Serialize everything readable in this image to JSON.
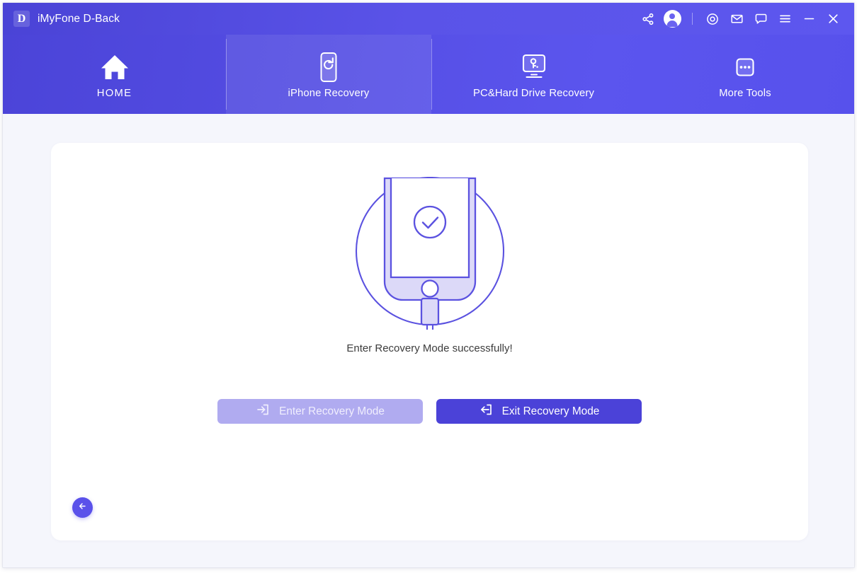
{
  "window": {
    "logo_letter": "D",
    "title": "iMyFone D-Back"
  },
  "titlebar": {
    "icons": [
      {
        "name": "share-icon",
        "glyph": "share"
      },
      {
        "name": "account-avatar-icon",
        "glyph": "avatar"
      },
      {
        "name": "separator",
        "glyph": "sep"
      },
      {
        "name": "target-icon",
        "glyph": "target"
      },
      {
        "name": "mail-icon",
        "glyph": "mail"
      },
      {
        "name": "feedback-chat-icon",
        "glyph": "chat"
      },
      {
        "name": "menu-icon",
        "glyph": "hamburger"
      },
      {
        "name": "minimize-icon",
        "glyph": "minimize"
      },
      {
        "name": "close-icon",
        "glyph": "close"
      }
    ]
  },
  "nav": {
    "tabs": [
      {
        "label": "HOME",
        "icon": "home-icon",
        "active": false
      },
      {
        "label": "iPhone Recovery",
        "icon": "phone-refresh-icon",
        "active": true
      },
      {
        "label": "PC&Hard Drive Recovery",
        "icon": "monitor-key-icon",
        "active": false
      },
      {
        "label": "More Tools",
        "icon": "more-dots-icon",
        "active": false
      }
    ]
  },
  "main": {
    "illustration": "phone-recovery-success-illustration",
    "status_text": "Enter Recovery Mode successfully!",
    "buttons": {
      "enter": {
        "label": "Enter Recovery Mode",
        "icon": "arrow-into-box-icon",
        "state": "disabled"
      },
      "exit": {
        "label": "Exit Recovery Mode",
        "icon": "arrow-out-of-box-icon",
        "state": "enabled"
      }
    },
    "back_button": {
      "icon": "arrow-left-icon"
    }
  },
  "colors": {
    "brand_purple": "#4b42d8",
    "header_gradient_start": "#4a43d6",
    "header_gradient_end": "#5d57ef",
    "page_background": "#f5f6fc",
    "card_background": "#ffffff",
    "button_disabled": "#b0abf0",
    "illustration_stroke": "#5b52e0",
    "illustration_fill": "#dcd9f8",
    "status_text_color": "#3c3c3c"
  }
}
